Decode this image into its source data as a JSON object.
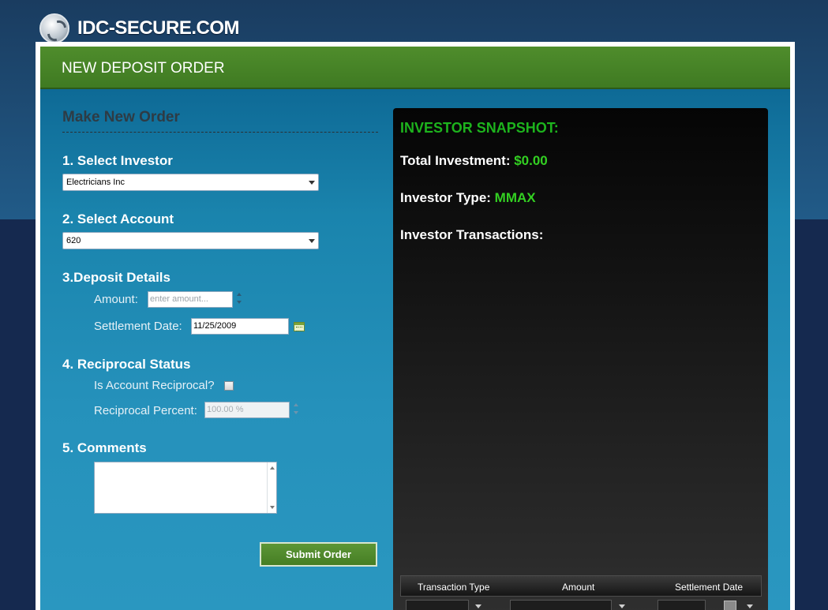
{
  "site": {
    "brand": "IDC-SECURE.COM"
  },
  "page": {
    "title": "NEW DEPOSIT ORDER"
  },
  "form": {
    "heading": "Make New Order",
    "step1": {
      "label": "1. Select Investor",
      "value": "Electricians Inc"
    },
    "step2": {
      "label": "2. Select Account",
      "value": "620"
    },
    "step3": {
      "label": "3.Deposit Details",
      "amount_label": "Amount:",
      "amount_placeholder": "enter amount...",
      "settlement_label": "Settlement Date:",
      "settlement_value": "11/25/2009"
    },
    "step4": {
      "label": "4. Reciprocal Status",
      "reciprocal_question": "Is Account Reciprocal?",
      "reciprocal_checked": false,
      "percent_label": "Reciprocal Percent:",
      "percent_value": "100.00 %"
    },
    "step5": {
      "label": "5. Comments",
      "value": ""
    },
    "submit_label": "Submit Order"
  },
  "snapshot": {
    "title": "INVESTOR SNAPSHOT:",
    "total_label": "Total Investment:",
    "total_value": "$0.00",
    "type_label": "Investor Type:",
    "type_value": "MMAX",
    "transactions_label": "Investor Transactions:",
    "columns": [
      "Transaction Type",
      "Amount",
      "Settlement Date"
    ]
  },
  "colors": {
    "header_green": "#4a8a2a",
    "snapshot_accent": "#33d022",
    "content_blue": "#2591bb"
  }
}
